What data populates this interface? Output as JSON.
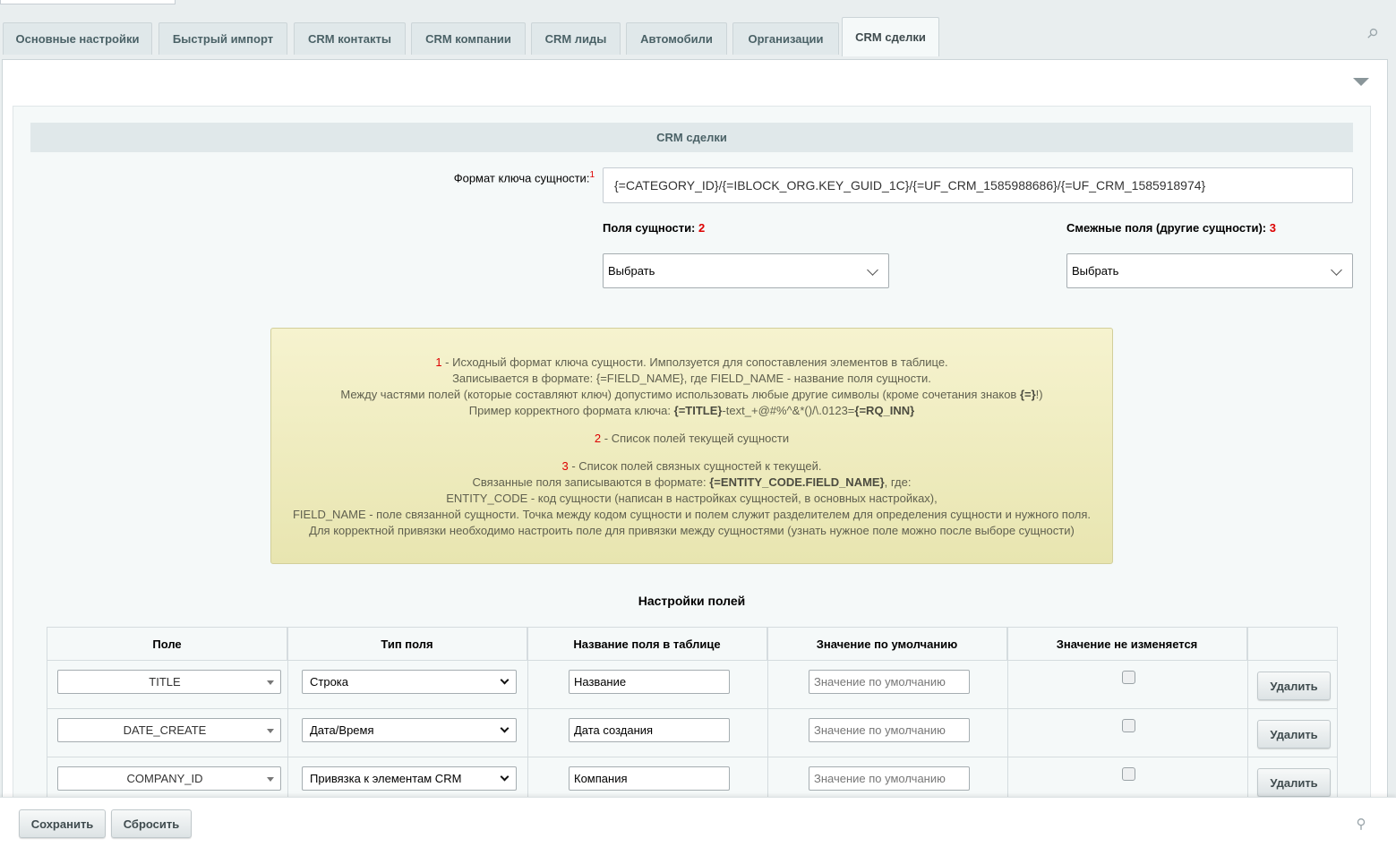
{
  "tabs": [
    {
      "label": "Основные настройки"
    },
    {
      "label": "Быстрый импорт"
    },
    {
      "label": "CRM контакты"
    },
    {
      "label": "CRM компании"
    },
    {
      "label": "CRM лиды"
    },
    {
      "label": "Автомобили"
    },
    {
      "label": "Организации"
    },
    {
      "label": "CRM сделки"
    }
  ],
  "active_tab": "CRM сделки",
  "section": {
    "title": "CRM сделки"
  },
  "key_format": {
    "label": "Формат ключа сущности:",
    "marker": "1",
    "value": "{=CATEGORY_ID}/{=IBLOCK_ORG.KEY_GUID_1C}/{=UF_CRM_1585988686}/{=UF_CRM_1585918974}"
  },
  "entity_fields": {
    "label": "Поля сущности:",
    "marker": "2",
    "selected": "Выбрать"
  },
  "related_fields": {
    "label": "Смежные поля (другие сущности):",
    "marker": "3",
    "selected": "Выбрать"
  },
  "note": {
    "m1": "1",
    "l1": " - Исходный формат ключа сущности. Имползуется для сопоставления элементов в таблице.",
    "l2": "Записывается в формате: {=FIELD_NAME}, где FIELD_NAME - название поля сущности.",
    "l3a": "Между частями полей (которые составляют ключ) допустимо использовать любые другие символы (кроме сочетания знаков ",
    "l3b": "{=}",
    "l3c": "!)",
    "l4a": "Пример корректного формата ключа: ",
    "l4b": "{=TITLE}",
    "l4c": "-text_+@#%^&*()/\\.0123=",
    "l4d": "{=RQ_INN}",
    "m2": "2",
    "l5": " - Список полей текущей сущности",
    "m3": "3",
    "l6": " - Список полей связных сущностей к текущей.",
    "l7a": "Связанные поля записываются в формате: ",
    "l7b": "{=ENTITY_CODE.FIELD_NAME}",
    "l7c": ", где:",
    "l8": "ENTITY_CODE - код сущности (написан в настройках сущностей, в основных настройках),",
    "l9": "FIELD_NAME - поле связанной сущности. Точка между кодом сущности и полем служит разделителем для определения сущности и нужного поля.",
    "l10": "Для корректной привязки необходимо настроить поле для привязки между сущностями (узнать нужное поле можно после выборе сущности)"
  },
  "settings_title": "Настройки полей",
  "table": {
    "headers": [
      "Поле",
      "Тип поля",
      "Название поля в таблице",
      "Значение по умолчанию",
      "Значение не изменяется",
      ""
    ],
    "default_placeholder": "Значение по умолчанию",
    "delete_label": "Удалить",
    "rows": [
      {
        "field": "TITLE",
        "type": "Строка",
        "name": "Название",
        "default": "",
        "fixed": false
      },
      {
        "field": "DATE_CREATE",
        "type": "Дата/Время",
        "name": "Дата создания",
        "default": "",
        "fixed": false
      },
      {
        "field": "COMPANY_ID",
        "type": "Привязка к элементам CRM",
        "name": "Компания",
        "default": "",
        "fixed": false
      }
    ]
  },
  "footer": {
    "save_label": "Сохранить",
    "reset_label": "Сбросить"
  },
  "colors": {
    "accent_red": "#dd0000",
    "note_bg": "#f2efc4",
    "tab_bg": "#e0e8ea"
  },
  "icons": {
    "pin_top": "pin-icon",
    "collapse": "triangle-down-icon",
    "pin_bottom": "pin-icon"
  }
}
